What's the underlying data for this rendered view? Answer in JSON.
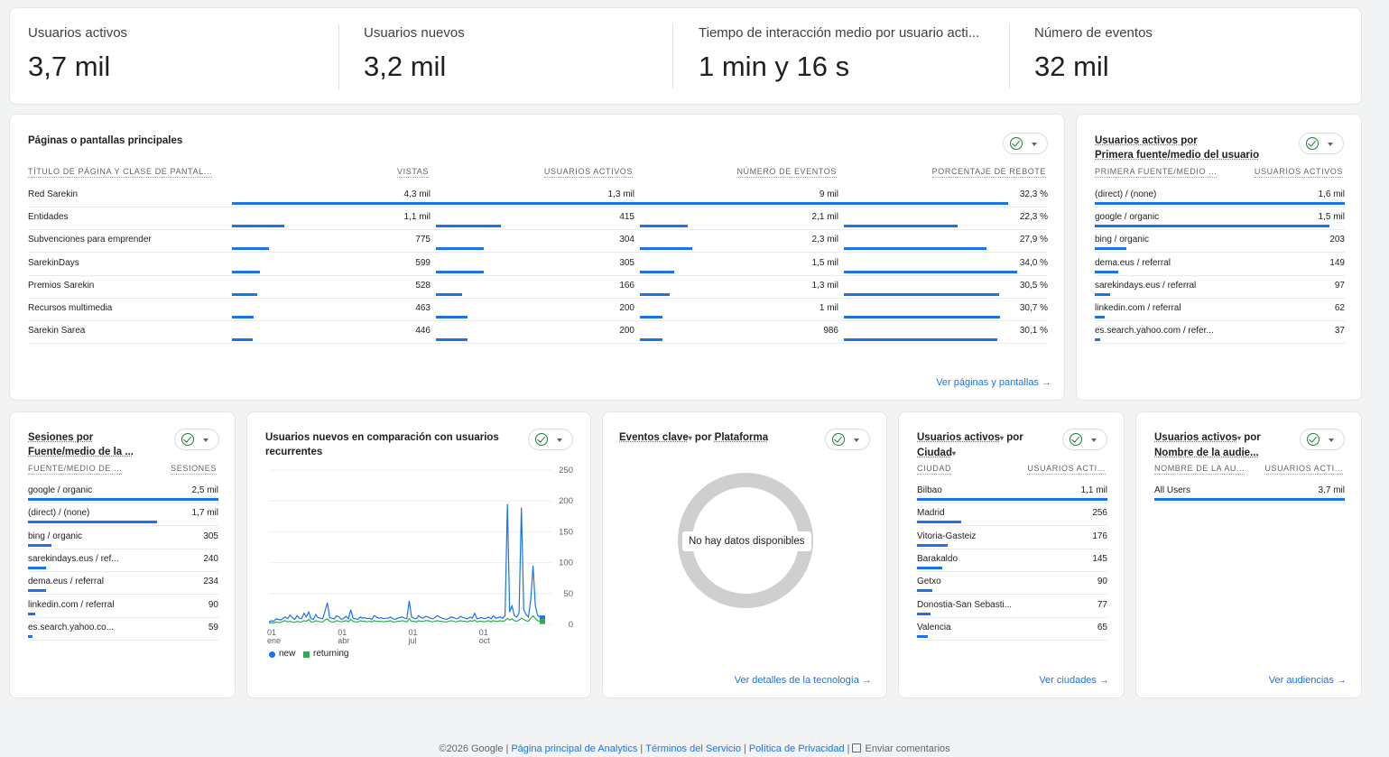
{
  "kpis": [
    {
      "label": "Usuarios activos",
      "value": "3,7 mil"
    },
    {
      "label": "Usuarios nuevos",
      "value": "3,2 mil"
    },
    {
      "label": "Tiempo de interacción medio por usuario acti...",
      "value": "1 min y 16 s"
    },
    {
      "label": "Número de eventos",
      "value": "32 mil"
    }
  ],
  "pages_card": {
    "title": "Páginas o pantallas principales",
    "headers": [
      "TÍTULO DE PÁGINA Y CLASE DE PANTAL...",
      "VISTAS",
      "USUARIOS ACTIVOS",
      "NÚMERO DE EVENTOS",
      "PORCENTAJE DE REBOTE"
    ],
    "rows": [
      {
        "title": "Red Sarekin",
        "views": "4,3 mil",
        "users": "1,3 mil",
        "events": "9 mil",
        "bounce": "32,3 %"
      },
      {
        "title": "Entidades",
        "views": "1,1 mil",
        "users": "415",
        "events": "2,1 mil",
        "bounce": "22,3 %"
      },
      {
        "title": "Subvenciones para emprender",
        "views": "775",
        "users": "304",
        "events": "2,3 mil",
        "bounce": "27,9 %"
      },
      {
        "title": "SarekinDays",
        "views": "599",
        "users": "305",
        "events": "1,5 mil",
        "bounce": "34,0 %"
      },
      {
        "title": "Premios Sarekin",
        "views": "528",
        "users": "166",
        "events": "1,3 mil",
        "bounce": "30,5 %"
      },
      {
        "title": "Recursos multimedia",
        "views": "463",
        "users": "200",
        "events": "1 mil",
        "bounce": "30,7 %"
      },
      {
        "title": "Sarekin Sarea",
        "views": "446",
        "users": "200",
        "events": "986",
        "bounce": "30,1 %"
      }
    ],
    "link": "Ver páginas y pantallas"
  },
  "source_card": {
    "title_line1": "Usuarios activos por",
    "title_line2": "Primera fuente/medio del usuario",
    "headers": [
      "PRIMERA FUENTE/MEDIO ...",
      "USUARIOS ACTIVOS"
    ],
    "rows": [
      {
        "label": "(direct) / (none)",
        "value": "1,6 mil"
      },
      {
        "label": "google / organic",
        "value": "1,5 mil"
      },
      {
        "label": "bing / organic",
        "value": "203"
      },
      {
        "label": "dema.eus / referral",
        "value": "149"
      },
      {
        "label": "sarekindays.eus / referral",
        "value": "97"
      },
      {
        "label": "linkedin.com / referral",
        "value": "62"
      },
      {
        "label": "es.search.yahoo.com / refer...",
        "value": "37"
      }
    ]
  },
  "sessions_card": {
    "title_line1": "Sesiones por",
    "title_line2": "Fuente/medio de la ...",
    "headers": [
      "FUENTE/MEDIO DE ...",
      "SESIONES"
    ],
    "rows": [
      {
        "label": "google / organic",
        "value": "2,5 mil"
      },
      {
        "label": "(direct) / (none)",
        "value": "1,7 mil"
      },
      {
        "label": "bing / organic",
        "value": "305"
      },
      {
        "label": "sarekindays.eus / ref...",
        "value": "240"
      },
      {
        "label": "dema.eus / referral",
        "value": "234"
      },
      {
        "label": "linkedin.com / referral",
        "value": "90"
      },
      {
        "label": "es.search.yahoo.co...",
        "value": "59"
      }
    ]
  },
  "newret_card": {
    "title_line1": "Usuarios nuevos en comparación con usuarios",
    "title_line2": "recurrentes",
    "legend_new": "new",
    "legend_returning": "returning"
  },
  "events_card": {
    "title_prefix": "Eventos clave",
    "title_mid": " por ",
    "title_dim": "Plataforma",
    "no_data": "No hay datos disponibles",
    "link": "Ver detalles de la tecnología"
  },
  "city_card": {
    "title_line1": "Usuarios activos",
    "title_mid": " por",
    "title_line2": "Ciudad",
    "headers": [
      "CIUDAD",
      "USUARIOS ACTI..."
    ],
    "rows": [
      {
        "label": "Bilbao",
        "value": "1,1 mil"
      },
      {
        "label": "Madrid",
        "value": "256"
      },
      {
        "label": "Vitoria-Gasteiz",
        "value": "176"
      },
      {
        "label": "Barakaldo",
        "value": "145"
      },
      {
        "label": "Getxo",
        "value": "90"
      },
      {
        "label": "Donostia-San Sebasti...",
        "value": "77"
      },
      {
        "label": "Valencia",
        "value": "65"
      }
    ],
    "link": "Ver ciudades"
  },
  "aud_card": {
    "title_line1": "Usuarios activos",
    "title_mid": " por",
    "title_line2": "Nombre de la audie...",
    "headers": [
      "NOMBRE DE LA AU...",
      "USUARIOS ACTI..."
    ],
    "rows": [
      {
        "label": "All Users",
        "value": "3,7 mil"
      }
    ],
    "link": "Ver audiencias"
  },
  "footer": {
    "copyright": "©2026 Google",
    "home": "Página principal de Analytics",
    "terms": "Términos del Servicio",
    "privacy": "Política de Privacidad",
    "feedback": "Enviar comentarios"
  },
  "colors": {
    "accent": "#1a73e8",
    "returning": "#34a853",
    "ok": "#188038"
  },
  "chart_data": {
    "type": "line",
    "x_ticks": [
      {
        "day": "01",
        "month": "ene"
      },
      {
        "day": "01",
        "month": "abr"
      },
      {
        "day": "01",
        "month": "jul"
      },
      {
        "day": "01",
        "month": "oct"
      }
    ],
    "y_ticks": [
      250,
      200,
      150,
      100,
      50,
      0
    ],
    "ylim": [
      0,
      250
    ],
    "series": [
      {
        "name": "new",
        "color": "#1a73e8",
        "values": [
          4,
          6,
          5,
          9,
          8,
          7,
          10,
          12,
          9,
          15,
          11,
          8,
          14,
          10,
          9,
          18,
          12,
          20,
          9,
          8,
          16,
          11,
          10,
          9,
          22,
          35,
          11,
          10,
          9,
          14,
          12,
          8,
          10,
          13,
          9,
          24,
          10,
          9,
          8,
          12,
          10,
          11,
          9,
          10,
          8,
          14,
          12,
          10,
          11,
          9,
          10,
          10,
          12,
          9,
          8,
          10,
          11,
          12,
          10,
          9,
          38,
          12,
          10,
          9,
          14,
          11,
          10,
          13,
          12,
          10,
          9,
          11,
          14,
          12,
          10,
          9,
          8,
          10,
          12,
          11,
          9,
          10,
          13,
          11,
          10,
          9,
          12,
          10,
          18,
          9,
          10,
          11,
          9,
          10,
          12,
          9,
          14,
          10,
          11,
          12,
          10,
          14,
          195,
          20,
          30,
          14,
          12,
          18,
          189,
          24,
          16,
          12,
          40,
          95,
          30,
          14,
          12,
          10
        ]
      },
      {
        "name": "returning",
        "color": "#34a853",
        "values": [
          2,
          3,
          2,
          4,
          3,
          3,
          5,
          6,
          4,
          5,
          4,
          3,
          5,
          4,
          4,
          6,
          5,
          8,
          4,
          4,
          6,
          5,
          4,
          4,
          7,
          9,
          5,
          4,
          4,
          6,
          5,
          4,
          5,
          6,
          4,
          8,
          5,
          4,
          4,
          6,
          5,
          5,
          4,
          5,
          4,
          6,
          5,
          5,
          5,
          4,
          5,
          5,
          6,
          4,
          4,
          5,
          5,
          6,
          5,
          4,
          9,
          5,
          5,
          4,
          6,
          5,
          5,
          6,
          6,
          5,
          4,
          5,
          6,
          5,
          5,
          4,
          4,
          5,
          6,
          5,
          4,
          5,
          6,
          5,
          5,
          4,
          6,
          5,
          7,
          4,
          5,
          5,
          4,
          5,
          6,
          4,
          6,
          5,
          5,
          6,
          5,
          6,
          10,
          7,
          9,
          6,
          5,
          7,
          10,
          8,
          6,
          5,
          10,
          14,
          9,
          6,
          5,
          5
        ]
      }
    ]
  }
}
